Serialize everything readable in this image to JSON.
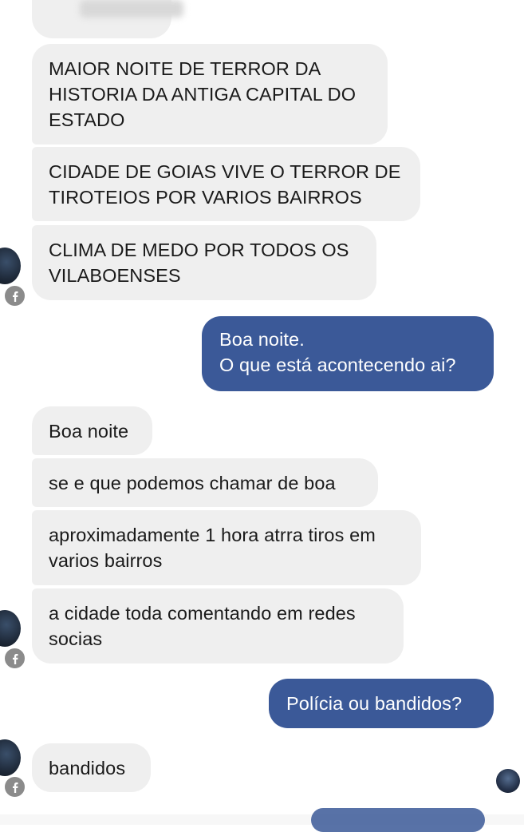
{
  "messages": {
    "m1": "MAIOR NOITE DE TERROR DA\nHISTORIA DA ANTIGA CAPITAL DO\nESTADO",
    "m2": "CIDADE DE GOIAS VIVE O TERROR DE\nTIROTEIOS POR VARIOS BAIRROS",
    "m3": "CLIMA DE MEDO POR TODOS OS\nVILABOENSES",
    "m4": "Boa noite.\nO que está acontecendo ai?",
    "m5": "Boa noite",
    "m6": "se e que podemos chamar de boa",
    "m7": "aproximadamente 1 hora atrra tiros em\nvarios bairros",
    "m8": "a cidade toda comentando em redes\nsocias",
    "m9": "Polícia ou bandidos?",
    "m10": "bandidos"
  },
  "icons": {
    "badge": "facebook-icon",
    "avatar": "profile-avatar"
  },
  "colors": {
    "outgoing": "#3b5998",
    "incoming": "#efefef",
    "badge": "#8b8b8b"
  }
}
